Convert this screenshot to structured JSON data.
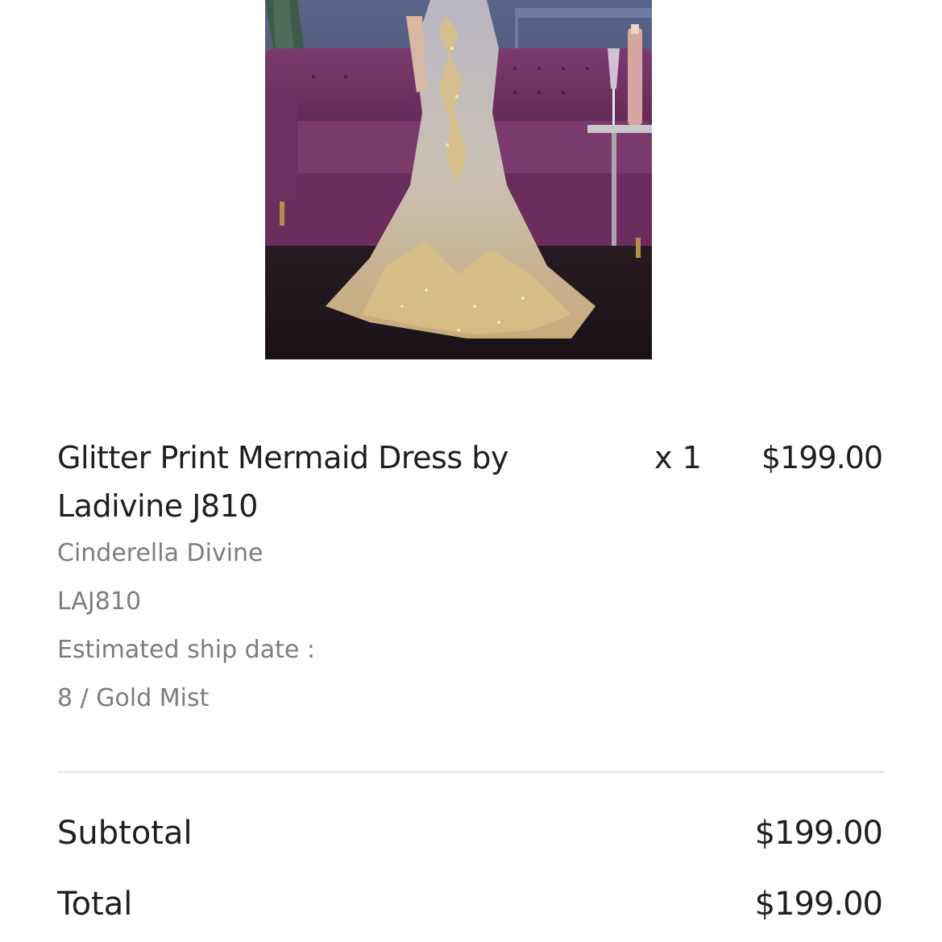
{
  "product": {
    "image_alt": "Glitter Print Mermaid Dress product photo",
    "title": "Glitter Print Mermaid Dress by Ladivine J810",
    "quantity": "x 1",
    "price": "$199.00",
    "brand": "Cinderella Divine",
    "sku": "LAJ810",
    "ship_date_label": "Estimated ship date :",
    "variant": "8 / Gold Mist"
  },
  "summary": {
    "subtotal_label": "Subtotal",
    "subtotal_value": "$199.00",
    "total_label": "Total",
    "total_value": "$199.00"
  }
}
